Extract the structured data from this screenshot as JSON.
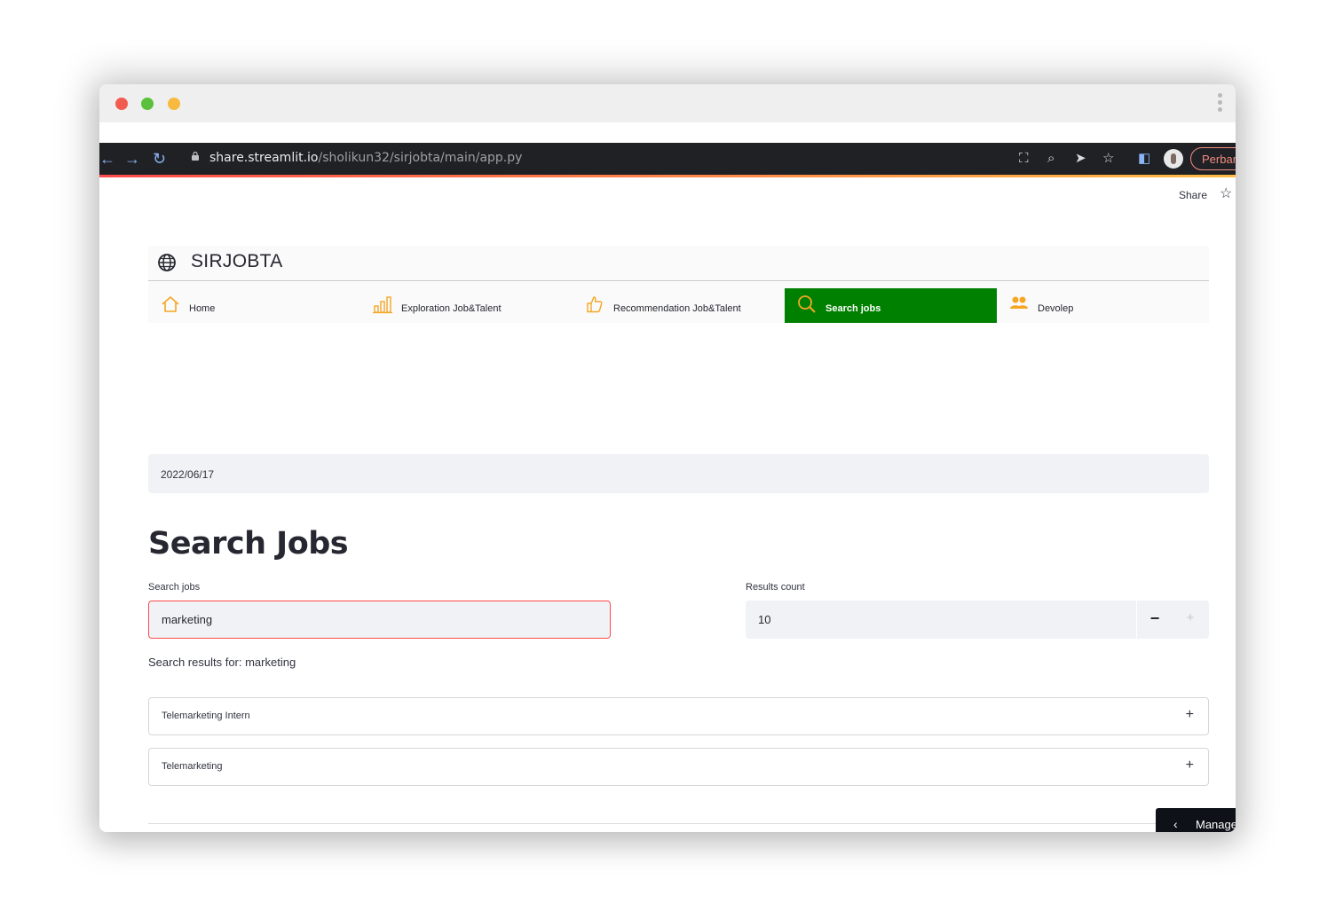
{
  "browser": {
    "url_host": "share.streamlit.io",
    "url_path": "/sholikun32/sirjobta/main/app.py",
    "update_button": "Perbarui"
  },
  "page": {
    "share_label": "Share",
    "brand_title": "SIRJOBTA",
    "menu": [
      {
        "label": "Home",
        "icon": "home-icon",
        "active": false
      },
      {
        "label": "Exploration Job&Talent",
        "icon": "bar-chart-icon",
        "active": false
      },
      {
        "label": "Recommendation Job&Talent",
        "icon": "thumbs-up-icon",
        "active": false
      },
      {
        "label": "Search jobs",
        "icon": "search-icon",
        "active": true
      },
      {
        "label": "Devolep",
        "icon": "people-icon",
        "active": false
      }
    ],
    "date": "2022/06/17",
    "heading": "Search Jobs",
    "search": {
      "label": "Search jobs",
      "value": "marketing"
    },
    "results_count": {
      "label": "Results count",
      "value": "10",
      "minus": "−",
      "plus": "+"
    },
    "results_text": "Search results for: marketing",
    "results": [
      {
        "title": "Telemarketing Intern"
      },
      {
        "title": "Telemarketing"
      }
    ],
    "expand_symbol": "+",
    "manage_label": "Manage app"
  },
  "colors": {
    "active_menu": "#008000",
    "menu_icon": "#f5a623",
    "input_focus_border": "#ff4b4b"
  }
}
